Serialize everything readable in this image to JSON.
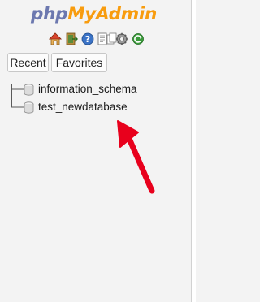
{
  "logo": {
    "part1": "php",
    "part2": "MyAdmin"
  },
  "toolbar": {
    "icons": [
      "home-icon",
      "exit-icon",
      "help-icon",
      "documentation-icon",
      "copy-icon",
      "settings-icon",
      "reload-icon"
    ]
  },
  "tabs": {
    "recent": "Recent",
    "favorites": "Favorites"
  },
  "databases": [
    {
      "name": "information_schema"
    },
    {
      "name": "test_newdatabase"
    }
  ],
  "colors": {
    "php": "#6c78af",
    "myadmin": "#f89c0e",
    "arrow": "#e8001c"
  }
}
